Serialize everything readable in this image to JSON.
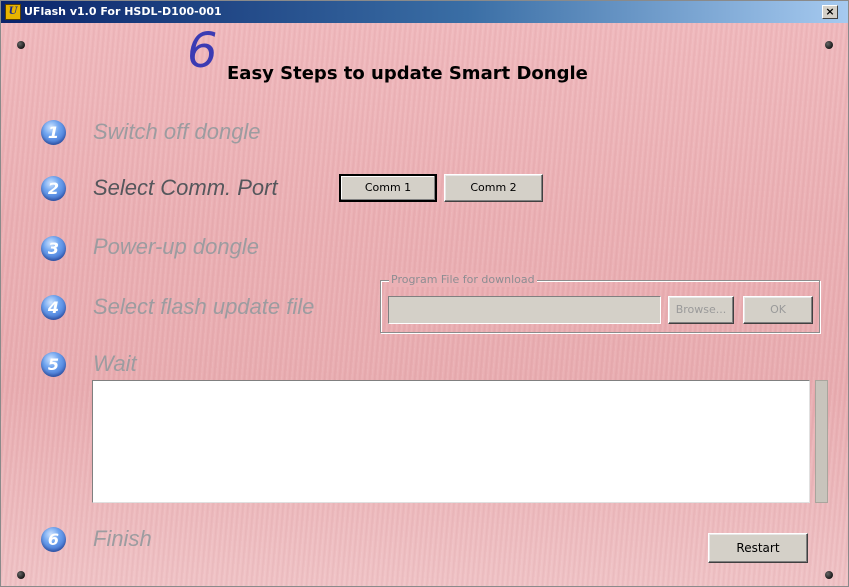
{
  "window": {
    "title": "UFlash v1.0 For HSDL-D100-001",
    "icon_name": "uflash-app-icon",
    "close_label": "×"
  },
  "heading": {
    "number": "6",
    "text": "Easy Steps to update Smart Dongle"
  },
  "steps": [
    {
      "number": "1",
      "label": "Switch off dongle",
      "state": "inactive"
    },
    {
      "number": "2",
      "label": "Select Comm. Port",
      "state": "active"
    },
    {
      "number": "3",
      "label": "Power-up dongle",
      "state": "inactive"
    },
    {
      "number": "4",
      "label": "Select flash update file",
      "state": "inactive"
    },
    {
      "number": "5",
      "label": "Wait",
      "state": "inactive"
    },
    {
      "number": "6",
      "label": "Finish",
      "state": "inactive"
    }
  ],
  "comm": {
    "comm1_label": "Comm 1",
    "comm2_label": "Comm 2",
    "selected": "Comm 1"
  },
  "program_file": {
    "group_label": "Program File for download",
    "value": "",
    "browse_label": "Browse...",
    "ok_label": "OK",
    "enabled": false
  },
  "log": {
    "text": ""
  },
  "restart_label": "Restart",
  "colors": {
    "heading_number": "#3b3bb3",
    "active_step": "#55575c",
    "inactive_step": "#9c9ca0",
    "badge": "#2f5fc9",
    "panel": "#ebb0b4"
  }
}
